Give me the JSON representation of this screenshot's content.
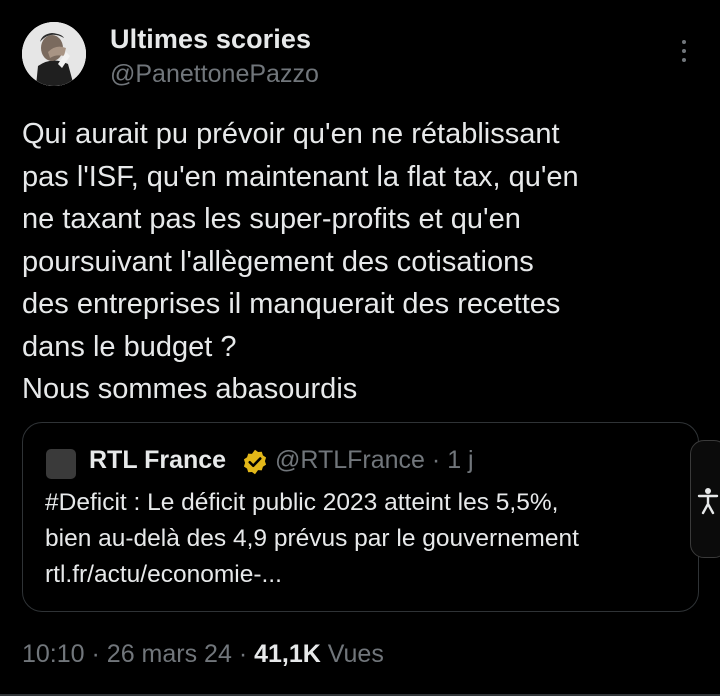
{
  "author": {
    "display_name": "Ultimes scories",
    "handle": "@PanettonePazzo",
    "avatar_icon": "facepalm-portrait-avatar"
  },
  "tweet": {
    "text": "Qui aurait pu prévoir qu'en ne rétablissant\npas l'ISF, qu'en maintenant la flat tax, qu'en\nne taxant pas les super-profits et qu'en\npoursuivant l'allègement des cotisations\ndes entreprises il manquerait des recettes\ndans le budget ?\nNous sommes abasourdis"
  },
  "quoted": {
    "name": "RTL France",
    "handle": "@RTLFrance",
    "time": "1 j",
    "verified_badge_color": "#e2b719",
    "text": "#Deficit : Le déficit public 2023 atteint les 5,5%,\nbien au-delà des 4,9 prévus par le gouvernement\nrtl.fr/actu/economie-..."
  },
  "footer": {
    "time": "10:10",
    "date": "26 mars 24",
    "views_count": "41,1K",
    "views_label": "Vues"
  },
  "colors": {
    "background": "#000000",
    "text": "#e7e9ea",
    "muted": "#71767b",
    "border": "#2f3336"
  }
}
